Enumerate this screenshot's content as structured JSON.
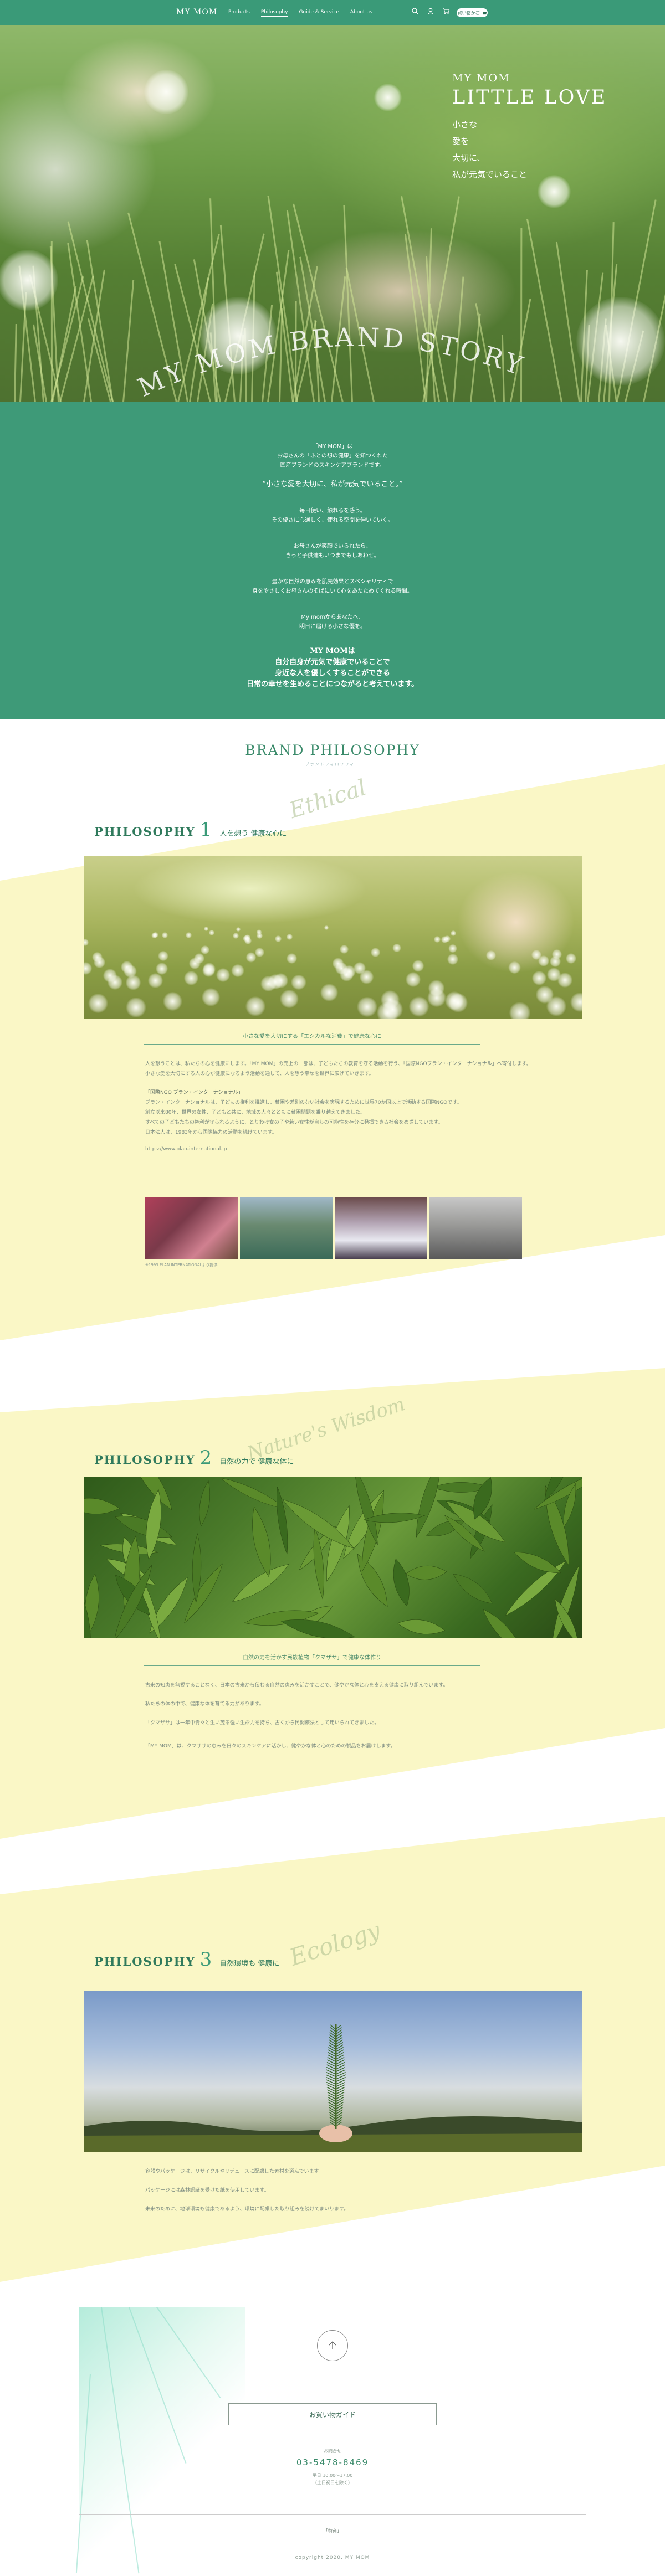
{
  "header": {
    "logo": "MY MOM",
    "nav": [
      "Products",
      "Philosophy",
      "Guide & Service",
      "About us"
    ],
    "active_nav": "Philosophy",
    "basket_label": "買い物かご",
    "icons": [
      "search-icon",
      "account-icon",
      "cart-icon",
      "basket-icon"
    ]
  },
  "hero": {
    "brand": "MY MOM",
    "title": "LITTLE LOVE",
    "lines": [
      "小さな",
      "愛を",
      "大切に、",
      "私が元気でいること"
    ],
    "arc_title": "MY MOM BRAND STORY"
  },
  "story": {
    "intro": [
      "「MY MOM」は",
      "お母さんの「ふとの想の健康」を知つくれた",
      "国産ブランドのスキンケアブランドです。"
    ],
    "tagline": "“小さな愛を大切に、私が元気でいること。”",
    "group2": [
      "毎日使い、触れるを感う。",
      "その優さに心通しく、使れる空間を伸いていく。"
    ],
    "group3": [
      "お母さんが笑顔でいられたら、",
      "きっと子供達もいつまでもしあわせ。"
    ],
    "group4": [
      "豊かな自然の恵みを肌先効果とスペシャリティで",
      "身をやさしくお母さんのそばにいて心をあたためてくれる時間。"
    ],
    "group5": [
      "My momからあなたへ、",
      "明日に届ける小さな優を。"
    ],
    "closing_title": "MY MOMは",
    "closing": [
      "自分自身が元気で健康でいることで",
      "身近な人を優しくすることができる",
      "日常の幸せを生めることにつながると考えています。"
    ]
  },
  "philosophy": {
    "heading": "BRAND PHILOSOPHY",
    "subheading": "ブランドフィロソフィー",
    "items": [
      {
        "label": "PHILOSOPHY",
        "number": "1",
        "title": "人を想う 健康な心に",
        "script": "Ethical",
        "caption": "小さな愛を大切にする「エシカルな消費」で健康な心に",
        "paragraphs": [
          "人を想うことは、私たちの心を健康にします。「MY MOM」の売上の一部は、子どもたちの教育を守る活動を行う、「国際NGOプラン・インターナショナル」へ寄付します。",
          "小さな愛を大切にする人の心が健康になるよう活動を通して、人を想う幸せを世界に広げていきます。",
          "「国際NGO プラン・インターナショナル」",
          "プラン・インターナショナルは、子どもの権利を推進し、貧困や差別のない社会を実現するために世界70か国以上で活動する国際NGOです。",
          "創立以来80年、世界の女性、子どもと共に、地域の人々とともに貧困問題を乗り越えてきました。",
          "すべての子どもたちの権利が守られるように、とりわけ女の子や若い女性が自らの可能性を存分に発揮できる社会をめざしています。",
          "日本法人は、1983年から国際協力の活動を続けています。",
          "https://www.plan-international.jp"
        ],
        "thumb_caption": "※1993.PLAN INTERNATIONALより提供"
      },
      {
        "label": "PHILOSOPHY",
        "number": "2",
        "title": "自然の力で 健康な体に",
        "script": "Nature's Wisdom",
        "caption": "自然の力を活かす民族植物「クマザサ」で健康な体作り",
        "paragraphs": [
          "古来の知恵を無視することなく、日本の古来から伝わる自然の恵みを活かすことで、健やかな体と心を支える健康に取り組んでいます。",
          "私たちの体の中で、健康な体を育てる力があります。",
          "「クマザサ」は一年中青々と生い茂る強い生命力を持ち、古くから民間療法として用いられてきました。",
          "「MY MOM」は、クマザサの恵みを日々のスキンケアに活かし、健やかな体と心のための製品をお届けします。"
        ]
      },
      {
        "label": "PHILOSOPHY",
        "number": "3",
        "title": "自然環境も 健康に",
        "script": "Ecology",
        "paragraphs": [
          "容器やパッケージは、リサイクルやリデュースに配慮した素材を選んでいます。",
          "パッケージには森林認証を受けた紙を使用しています。",
          "未来のために、地球環境も健康であるよう、環境に配慮した取り組みを続けてまいります。"
        ]
      }
    ]
  },
  "footer": {
    "guide_button": "お買い物ガイド",
    "contact_label": "お問合せ",
    "phone": "03-5478-8469",
    "hours": [
      "平日 10:00〜17:00",
      "（土日祝日を除く）"
    ],
    "links": "「特商」",
    "copyright": "copyright 2020. MY MOM"
  },
  "colors": {
    "green": "#3e9a78",
    "cream": "#faf7c6",
    "dark_green": "#2f7a5c"
  }
}
